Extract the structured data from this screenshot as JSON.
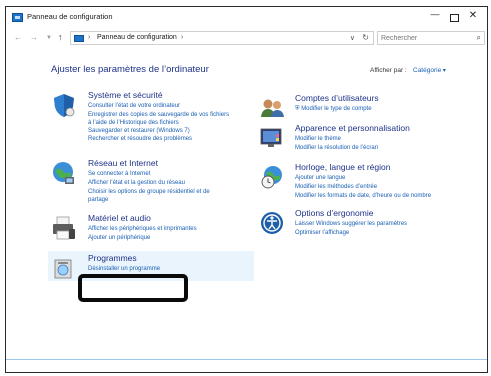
{
  "window": {
    "title": "Panneau de configuration",
    "controls": {
      "minimize": "—",
      "close": "✕"
    }
  },
  "address_bar": {
    "sep": "›",
    "crumb": "Panneau de configuration",
    "refresh": "↻",
    "dropdown": "∨"
  },
  "search": {
    "placeholder": "Rechercher"
  },
  "header": {
    "title": "Ajuster les paramètres de l’ordinateur",
    "view_by_label": "Afficher par :",
    "view_by_value": "Catégorie"
  },
  "categories": [
    {
      "title": "Système et sécurité",
      "icon": "shield-icon",
      "links": [
        "Consulter l’état de votre ordinateur",
        "Enregistrer des copies de sauvegarde de vos fichiers",
        "à l’aide de l’Historique des fichiers",
        "Sauvegarder et restaurer (Windows 7)",
        "Rechercher et résoudre des problèmes"
      ]
    },
    {
      "title": "Réseau et Internet",
      "icon": "globe-network-icon",
      "links": [
        "Se connecter à Internet",
        "Afficher l’état et la gestion du réseau",
        "Choisir les options de groupe résidentiel et de",
        "partage"
      ]
    },
    {
      "title": "Matériel et audio",
      "icon": "printer-icon",
      "links": [
        "Afficher les périphériques et imprimantes",
        "Ajouter un périphérique"
      ]
    },
    {
      "title": "Programmes",
      "icon": "programs-icon",
      "links": [
        "Désinstaller un programme"
      ]
    },
    {
      "title": "Comptes d’utilisateurs",
      "icon": "users-icon",
      "links": [
        "Modifier le type de compte"
      ]
    },
    {
      "title": "Apparence et personnalisation",
      "icon": "appearance-icon",
      "links": [
        "Modifier le thème",
        "Modifier la résolution de l’écran"
      ]
    },
    {
      "title": "Horloge, langue et région",
      "icon": "clock-globe-icon",
      "links": [
        "Ajouter une langue",
        "Modifier les méthodes d’entrée",
        "Modifier les formats de date, d’heure ou de nombre"
      ]
    },
    {
      "title": "Options d’ergonomie",
      "icon": "accessibility-icon",
      "links": [
        "Laisser Windows suggérer les paramètres",
        "Optimiser l’affichage"
      ]
    }
  ],
  "colors": {
    "title_blue": "#1e3287",
    "link_blue": "#1a5fb4",
    "hover_bg": "#eaf4fc",
    "annotation": "#0a0a0a"
  }
}
